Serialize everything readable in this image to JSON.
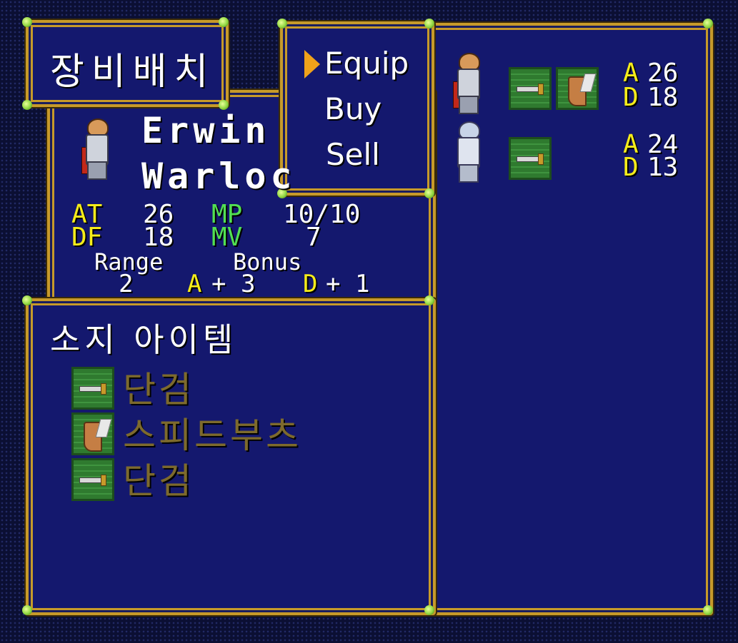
{
  "title_box": {
    "label": "장비배치"
  },
  "menu": {
    "items": [
      {
        "label": "Equip",
        "selected": true
      },
      {
        "label": "Buy",
        "selected": false
      },
      {
        "label": "Sell",
        "selected": false
      }
    ]
  },
  "character": {
    "name": "Erwin",
    "class": "Warloc",
    "stats": {
      "at_label": "AT",
      "at_value": "26",
      "mp_label": "MP",
      "mp_value": "10/10",
      "df_label": "DF",
      "df_value": "18",
      "mv_label": "MV",
      "mv_value": "7"
    },
    "range_label": "Range",
    "range_value": "2",
    "bonus_label": "Bonus",
    "bonus_a_label": "A",
    "bonus_a_value": "+ 3",
    "bonus_d_label": "D",
    "bonus_d_value": "+ 1"
  },
  "inventory": {
    "title": "소지 아이템",
    "items": [
      {
        "name": "단검",
        "icon": "dagger-icon"
      },
      {
        "name": "스피드부츠",
        "icon": "speed-boots-icon"
      },
      {
        "name": "단검",
        "icon": "dagger-icon"
      }
    ]
  },
  "party": [
    {
      "icons": [
        "dagger-icon",
        "speed-boots-icon"
      ],
      "a_label": "A",
      "a_value": "26",
      "d_label": "D",
      "d_value": "18"
    },
    {
      "icons": [
        "dagger-icon"
      ],
      "a_label": "A",
      "a_value": "24",
      "d_label": "D",
      "d_value": "13"
    }
  ],
  "colors": {
    "panel_bg": "#14186e",
    "frame_gold": "#c79a2a",
    "stat_yellow": "#f5ec1a",
    "stat_green": "#52e052",
    "item_text": "#7d6a2d",
    "cursor": "#f0a21a"
  }
}
